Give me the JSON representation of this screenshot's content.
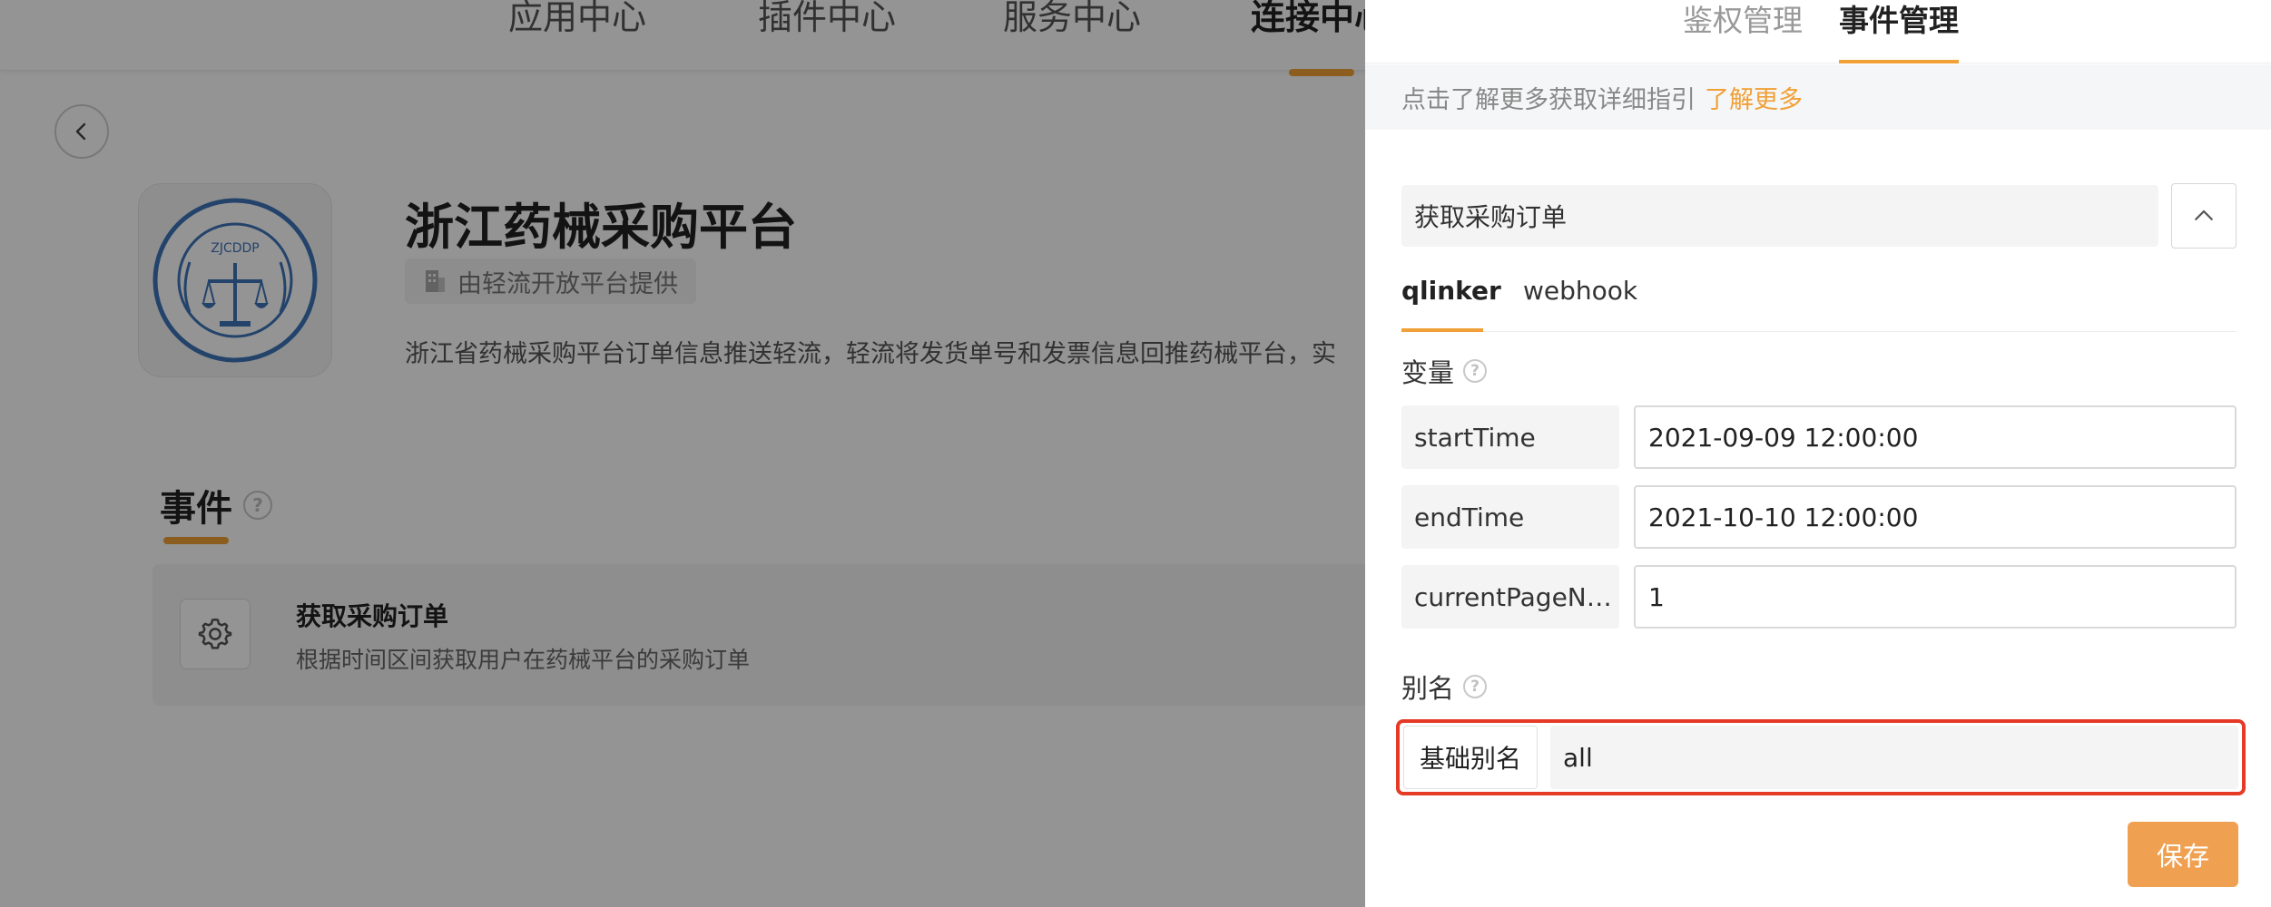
{
  "top_nav": {
    "items": [
      {
        "label": "应用中心"
      },
      {
        "label": "插件中心"
      },
      {
        "label": "服务中心"
      },
      {
        "label": "连接中心"
      }
    ]
  },
  "app": {
    "title": "浙江药械采购平台",
    "provider": "由轻流开放平台提供",
    "description": "浙江省药械采购平台订单信息推送轻流，轻流将发货单号和发票信息回推药械平台，实",
    "logo_text": "ZJCDDP"
  },
  "events_section": {
    "heading": "事件",
    "card": {
      "title": "获取采购订单",
      "description": "根据时间区间获取用户在药械平台的采购订单"
    }
  },
  "drawer": {
    "tabs": [
      {
        "label": "鉴权管理"
      },
      {
        "label": "事件管理"
      }
    ],
    "info_text": "点击了解更多获取详细指引",
    "learn_more": "了解更多",
    "event_select_value": "获取采购订单",
    "sub_tabs": [
      {
        "label": "qlinker"
      },
      {
        "label": "webhook"
      }
    ],
    "variables_label": "变量",
    "variables": [
      {
        "key": "startTime",
        "value": "2021-09-09 12:00:00"
      },
      {
        "key": "endTime",
        "value": "2021-10-10 12:00:00"
      },
      {
        "key": "currentPageN…",
        "value": "1"
      }
    ],
    "alias_label": "别名",
    "alias": {
      "key": "基础别名",
      "value": "all"
    },
    "save_label": "保存"
  },
  "colors": {
    "accent": "#f0a036",
    "highlight_border": "#e53a26",
    "save_button": "#f0a051"
  },
  "icons": {
    "back": "chevron-left-icon",
    "collapse": "chevron-up-icon",
    "event": "gear-icon",
    "provider": "building-icon",
    "help": "question-circle-icon"
  }
}
